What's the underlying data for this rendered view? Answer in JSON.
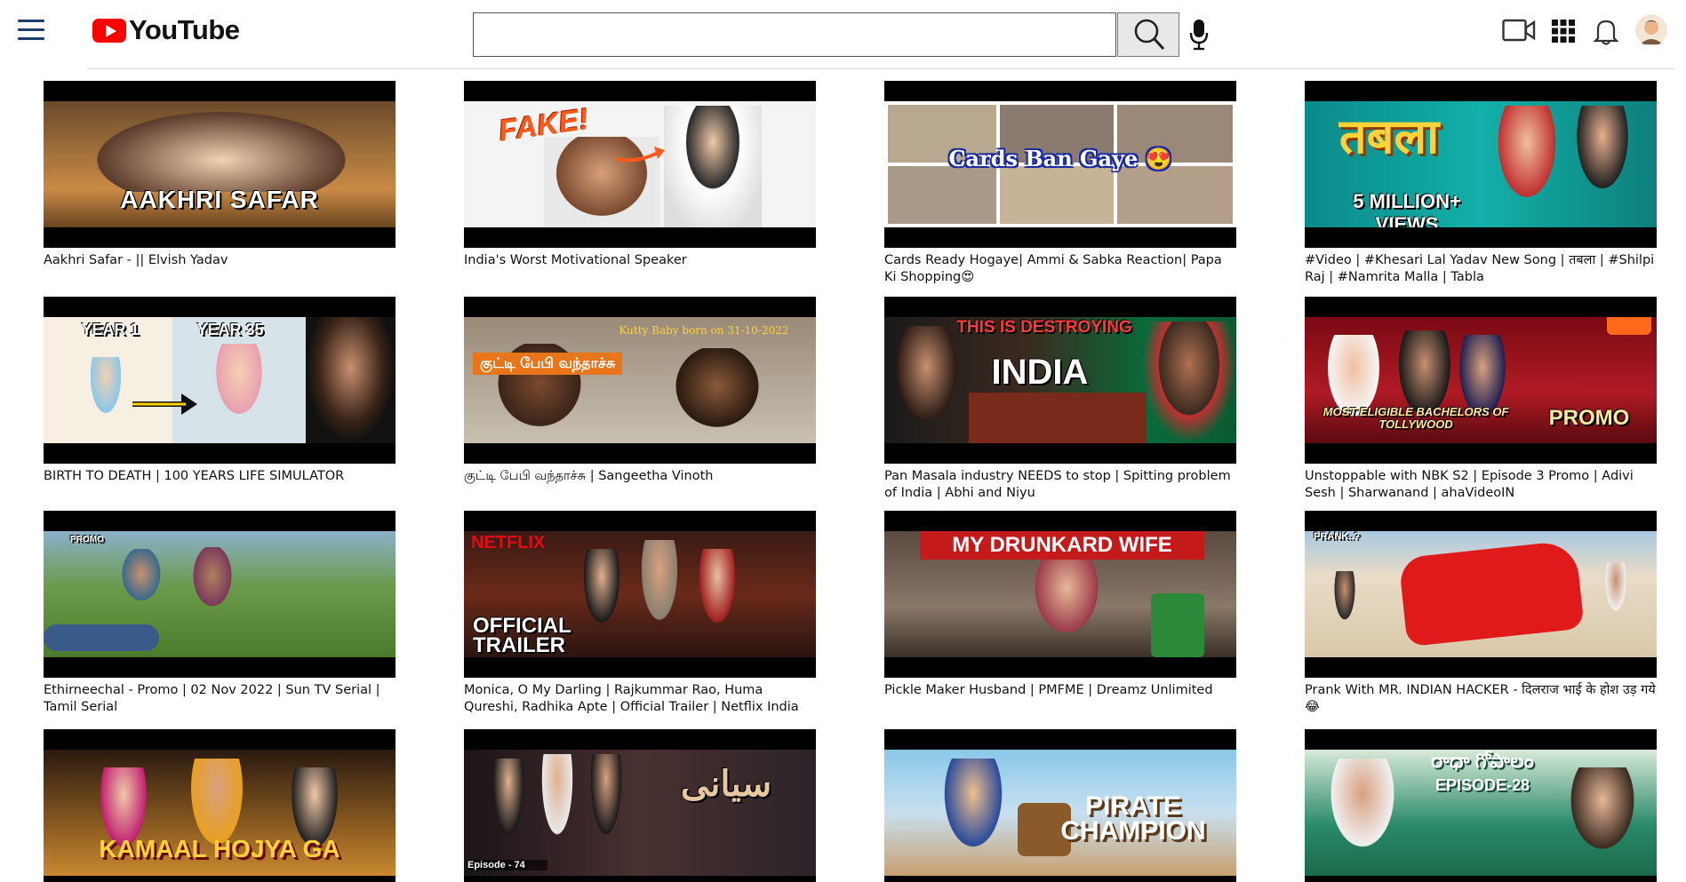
{
  "header": {
    "menu_icon": "hamburger-menu-icon",
    "logo_text": "YouTube",
    "search_placeholder": "",
    "search_value": "",
    "search_icon": "search-icon",
    "mic_icon": "microphone-icon",
    "create_icon": "video-camera-icon",
    "apps_icon": "apps-grid-icon",
    "notifications_icon": "bell-icon",
    "avatar_icon": "avatar"
  },
  "colors": {
    "brand_red": "#ff0000",
    "menu_blue": "#1f3f6b"
  },
  "videos": [
    {
      "title": "Aakhri Safar - || Elvish Yadav",
      "overlay": "AAKHRI SAFAR"
    },
    {
      "title": "India's Worst Motivational Speaker",
      "overlay": "FAKE!"
    },
    {
      "title": "Cards Ready Hogaye| Ammi & Sabka Reaction| Papa Ki Shopping😍",
      "overlay": "Cards Ban Gaye 😍"
    },
    {
      "title": "#Video | #Khesari Lal Yadav New Song | तबला | #Shilpi Raj | #Namrita Malla | Tabla",
      "overlay": "तबला",
      "overlay2": "5 MILLION+ VIEWS"
    },
    {
      "title": "BIRTH TO DEATH | 100 YEARS LIFE SIMULATOR",
      "overlay": "YEAR 1",
      "overlay2": "YEAR 35"
    },
    {
      "title": "குட்டி பேபி வந்தாச்சு | Sangeetha Vinoth",
      "overlay": "குட்டி பேபி வந்தாச்சு",
      "overlay2": "Kutty Baby born on 31-10-2022"
    },
    {
      "title": "Pan Masala industry NEEDS to stop | Spitting problem of India | Abhi and Niyu",
      "overlay": "THIS IS DESTROYING",
      "overlay2": "INDIA"
    },
    {
      "title": "Unstoppable with NBK S2 | Episode 3 Promo | Adivi Sesh | Sharwanand | ahaVideoIN",
      "overlay": "MOST ELIGIBLE BACHELORS OF TOLLYWOOD",
      "overlay2": "PROMO"
    },
    {
      "title": "Ethirneechal - Promo | 02 Nov 2022 | Sun TV Serial | Tamil Serial",
      "overlay": "PROMO"
    },
    {
      "title": "Monica, O My Darling | Rajkummar Rao, Huma Qureshi, Radhika Apte | Official Trailer | Netflix India",
      "overlay": "OFFICIAL TRAILER",
      "overlay2": "NETFLIX"
    },
    {
      "title": "Pickle Maker Husband | PMFME | Dreamz Unlimited",
      "overlay": "MY DRUNKARD WIFE"
    },
    {
      "title": "Prank With MR. INDIAN HACKER - दिलराज भाई के होश उड़ गये 😂",
      "overlay": "PRANK..?"
    },
    {
      "title": "",
      "overlay": "KAMAAL HOJYA GA"
    },
    {
      "title": "",
      "overlay": "سیانی",
      "overlay2": "Episode - 74"
    },
    {
      "title": "",
      "overlay": "PIRATE CHAMPION"
    },
    {
      "title": "",
      "overlay": "రాధా గోపాలం",
      "overlay2": "EPISODE-28"
    }
  ]
}
